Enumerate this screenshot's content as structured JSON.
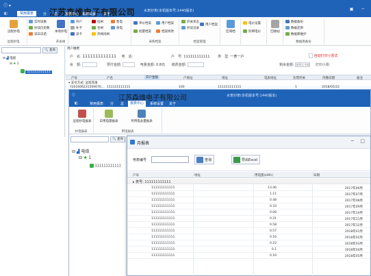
{
  "app": {
    "company_name": "江苏森维电子有限公司",
    "subtitle": "水表抄表(本机版本号:1440版本)",
    "window_controls": [
      "▣",
      "─",
      "✕"
    ]
  },
  "back_window": {
    "menu": [
      "◧",
      "常用报表",
      "分",
      "总",
      "报表中心",
      "系统设置",
      "关于"
    ],
    "menu_active_index": 1,
    "ribbon_groups": [
      {
        "label": "远程抄电",
        "items": [
          "远程抄电"
        ],
        "big": true
      },
      {
        "label": "",
        "items": [
          "实时读数",
          "抄读历史数",
          "读日冻结"
        ]
      },
      {
        "label": "开关阀",
        "items": [
          "本地抄电"
        ],
        "big": true
      },
      {
        "label": "",
        "items": [
          "开户",
          "补卡",
          "读卡"
        ]
      },
      {
        "label": "",
        "items": [
          "拉闸",
          "合闸",
          "开阀闭阀"
        ]
      },
      {
        "label": "",
        "items": [
          "售电",
          "保电"
        ]
      },
      {
        "label": "采购档案",
        "items": [
          "单价档案",
          "批量档案"
        ]
      },
      {
        "label": "",
        "items": [
          "用户档案",
          "档案修改"
        ]
      },
      {
        "label": "档案管理",
        "items": [
          "开关状态",
          "抄读记录",
          "用户档案"
        ]
      },
      {
        "label": "",
        "items": [
          "区域档"
        ]
      },
      {
        "label": "",
        "items": [
          "电价设置",
          "阶梯电价"
        ]
      },
      {
        "label": "",
        "items": [
          "回收站"
        ]
      },
      {
        "label": "数据库备份",
        "items": [
          "数据备份",
          "数据还原",
          "数据库维护"
        ]
      }
    ],
    "tree": {
      "search_button": "查询",
      "root": "电缆",
      "child": "1",
      "meter": "111111111111"
    },
    "tab_title": "用户缴费",
    "form": {
      "user_label": "户　名:",
      "user_value": "1111111111111",
      "phone_label": "电　话:",
      "account_label": "户　号:",
      "account_value": "111111111111",
      "type_label": "类　型:",
      "type_value": "一表一户",
      "balance_label": "余　额:",
      "prepay_label": "预付金额:",
      "rate_label": "电量金额:",
      "rate_value": "0.8元",
      "amount_label": "缴费金额:",
      "remain_label": "剩余金额:",
      "remain_value": "缴费后余额",
      "print_label": "打印小票:",
      "auto_label": "自动打印小票式"
    },
    "grid_header": [
      "户号",
      "户名",
      "开户金额",
      "户地址",
      "地址",
      "电表地址",
      "负荷开关",
      "内缴日期",
      "备注"
    ],
    "group_row": "支付方式: 远程充值",
    "data_row": {
      "id": "Y201606231509076...",
      "name": "111111111111",
      "amount": "100",
      "addr": "111111111111",
      "count": "1",
      "date": "2018/05/22"
    }
  },
  "middle_window": {
    "menu": [
      "◧",
      "常用报表",
      "分",
      "总",
      "报表中心",
      "系统设置",
      "关于"
    ],
    "menu_active_index": 4,
    "ribbon": [
      "远程抄电报表",
      "日用电量报表",
      "月用电总量报表"
    ],
    "ribbon_group_labels": [
      "抄电报表",
      "用电报表"
    ],
    "tree": {
      "search_button": "查询",
      "root": "电缆",
      "child": "1",
      "meter": "111111111111"
    }
  },
  "dialog": {
    "title": "月报表",
    "controls": [
      "─",
      "□"
    ],
    "query_label": "电表编号",
    "query_value": "",
    "query_button": "查询",
    "export_button": "导出Excel",
    "columns": [
      "户号",
      "地址",
      "用电量(kWh)",
      "日期"
    ],
    "group_row": "▸ 表号: 111111111111",
    "rows": [
      {
        "id": "111111111111",
        "kwh": "13.46",
        "date": "2017年06月"
      },
      {
        "id": "111111111111",
        "kwh": "1.11",
        "date": "2017年07月"
      },
      {
        "id": "111111111111",
        "kwh": "0.48",
        "date": "2017年08月"
      },
      {
        "id": "111111111111",
        "kwh": "0.33",
        "date": "2017年09月"
      },
      {
        "id": "111111111111",
        "kwh": "0.08",
        "date": "2017年10月"
      },
      {
        "id": "111111111111",
        "kwh": "0.31",
        "date": "2017年11月"
      },
      {
        "id": "111111111111",
        "kwh": "0.58",
        "date": "2017年12月"
      },
      {
        "id": "111111111111",
        "kwh": "0.57",
        "date": "2018年01月"
      },
      {
        "id": "111111111111",
        "kwh": "0.16",
        "date": "2018年02月"
      },
      {
        "id": "111111111111",
        "kwh": "0.22",
        "date": "2018年03月"
      },
      {
        "id": "111111111111",
        "kwh": "0.1",
        "date": "2018年04月"
      },
      {
        "id": "111111111111",
        "kwh": "0.16",
        "date": "2018年05月"
      }
    ]
  },
  "colors": {
    "titlebar": "#1e63b8",
    "selection": "#2a6bc6",
    "alert_text": "#d22222"
  }
}
